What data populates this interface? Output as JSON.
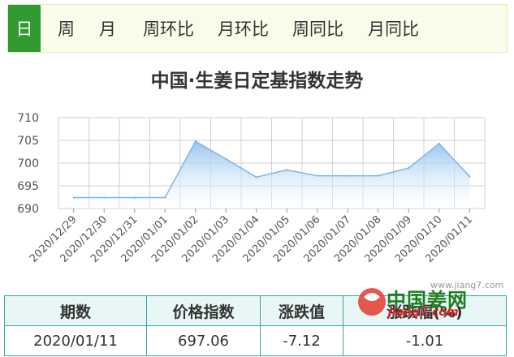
{
  "tabs": [
    "日",
    "周",
    "月",
    "周环比",
    "月环比",
    "周同比",
    "月同比"
  ],
  "chart_data": {
    "type": "area",
    "title": "中国·生姜日定基指数走势",
    "categories": [
      "2020/12/29",
      "2020/12/30",
      "2020/12/31",
      "2020/01/01",
      "2020/01/02",
      "2020/01/03",
      "2020/01/04",
      "2020/01/05",
      "2020/01/06",
      "2020/01/07",
      "2020/01/08",
      "2020/01/09",
      "2020/01/10",
      "2020/01/11"
    ],
    "values": [
      692.4,
      692.4,
      692.4,
      692.4,
      704.8,
      700.9,
      696.9,
      698.5,
      697.2,
      697.2,
      697.2,
      698.9,
      704.3,
      697.06
    ],
    "ylim": [
      690,
      710
    ],
    "yticks": [
      "690",
      "695",
      "700",
      "705",
      "710"
    ],
    "grid": true,
    "colors": {
      "line": "#7fb4e6",
      "fill_top": "#8fc0ee",
      "fill_bottom": "#ffffff",
      "grid": "#d0d0d0"
    }
  },
  "table": {
    "headers": [
      "期数",
      "价格指数",
      "涨跌值",
      "涨跌幅(%)"
    ],
    "row": [
      "2020/01/11",
      "697.06",
      "-7.12",
      "-1.01"
    ]
  },
  "watermark": {
    "url": "www.jiang7.com",
    "name": "中国姜网",
    "domain": "jiang7.com"
  }
}
